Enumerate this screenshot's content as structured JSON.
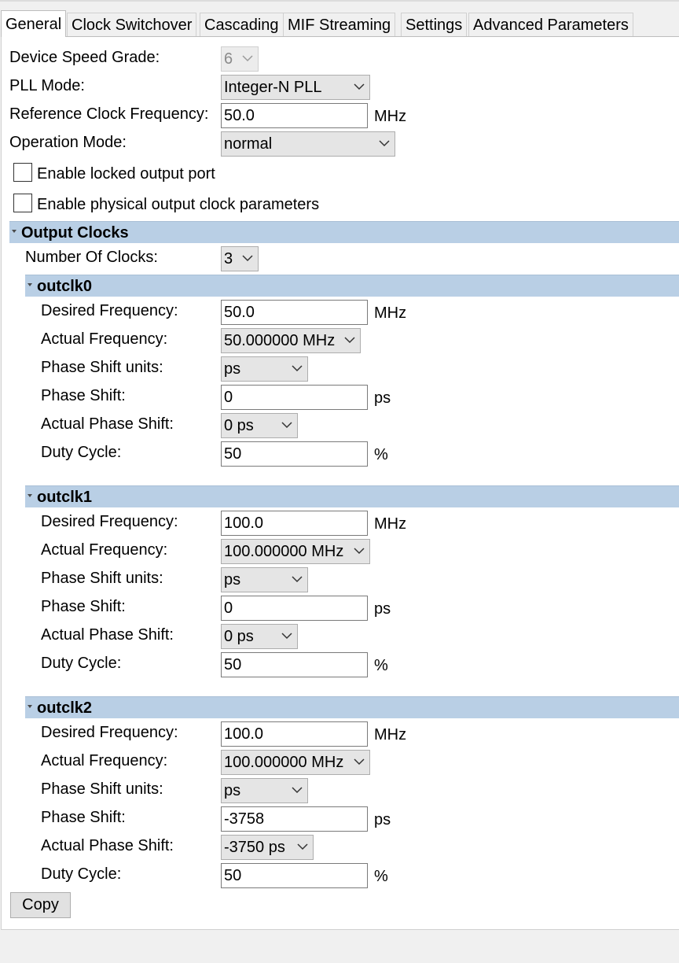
{
  "tabs": [
    "General",
    "Clock Switchover",
    "Cascading",
    "MIF Streaming",
    "Settings",
    "Advanced Parameters"
  ],
  "general": {
    "speed_grade": {
      "label": "Device Speed Grade:",
      "value": "6"
    },
    "pll_mode": {
      "label": "PLL Mode:",
      "value": "Integer-N PLL"
    },
    "ref_clock": {
      "label": "Reference Clock Frequency:",
      "value": "50.0",
      "unit": "MHz"
    },
    "op_mode": {
      "label": "Operation Mode:",
      "value": "normal"
    },
    "locked_port": {
      "label": "Enable locked output port",
      "checked": false
    },
    "physical_params": {
      "label": "Enable physical output clock parameters",
      "checked": false
    }
  },
  "output_clocks": {
    "title": "Output Clocks",
    "num_label": "Number Of Clocks:",
    "num_value": "3"
  },
  "field_labels": {
    "desired": "Desired Frequency:",
    "actual": "Actual Frequency:",
    "units": "Phase Shift units:",
    "shift": "Phase Shift:",
    "actual_shift": "Actual Phase Shift:",
    "duty": "Duty Cycle:"
  },
  "units": {
    "mhz": "MHz",
    "ps": "ps",
    "pct": "%"
  },
  "clocks": [
    {
      "name": "outclk0",
      "desired": "50.0",
      "actual": "50.000000 MHz",
      "shift_units": "ps",
      "shift": "0",
      "actual_shift": "0 ps",
      "duty": "50"
    },
    {
      "name": "outclk1",
      "desired": "100.0",
      "actual": "100.000000 MHz",
      "shift_units": "ps",
      "shift": "0",
      "actual_shift": "0 ps",
      "duty": "50"
    },
    {
      "name": "outclk2",
      "desired": "100.0",
      "actual": "100.000000 MHz",
      "shift_units": "ps",
      "shift": "-3758",
      "actual_shift": "-3750 ps",
      "duty": "50"
    }
  ],
  "copy_label": "Copy"
}
